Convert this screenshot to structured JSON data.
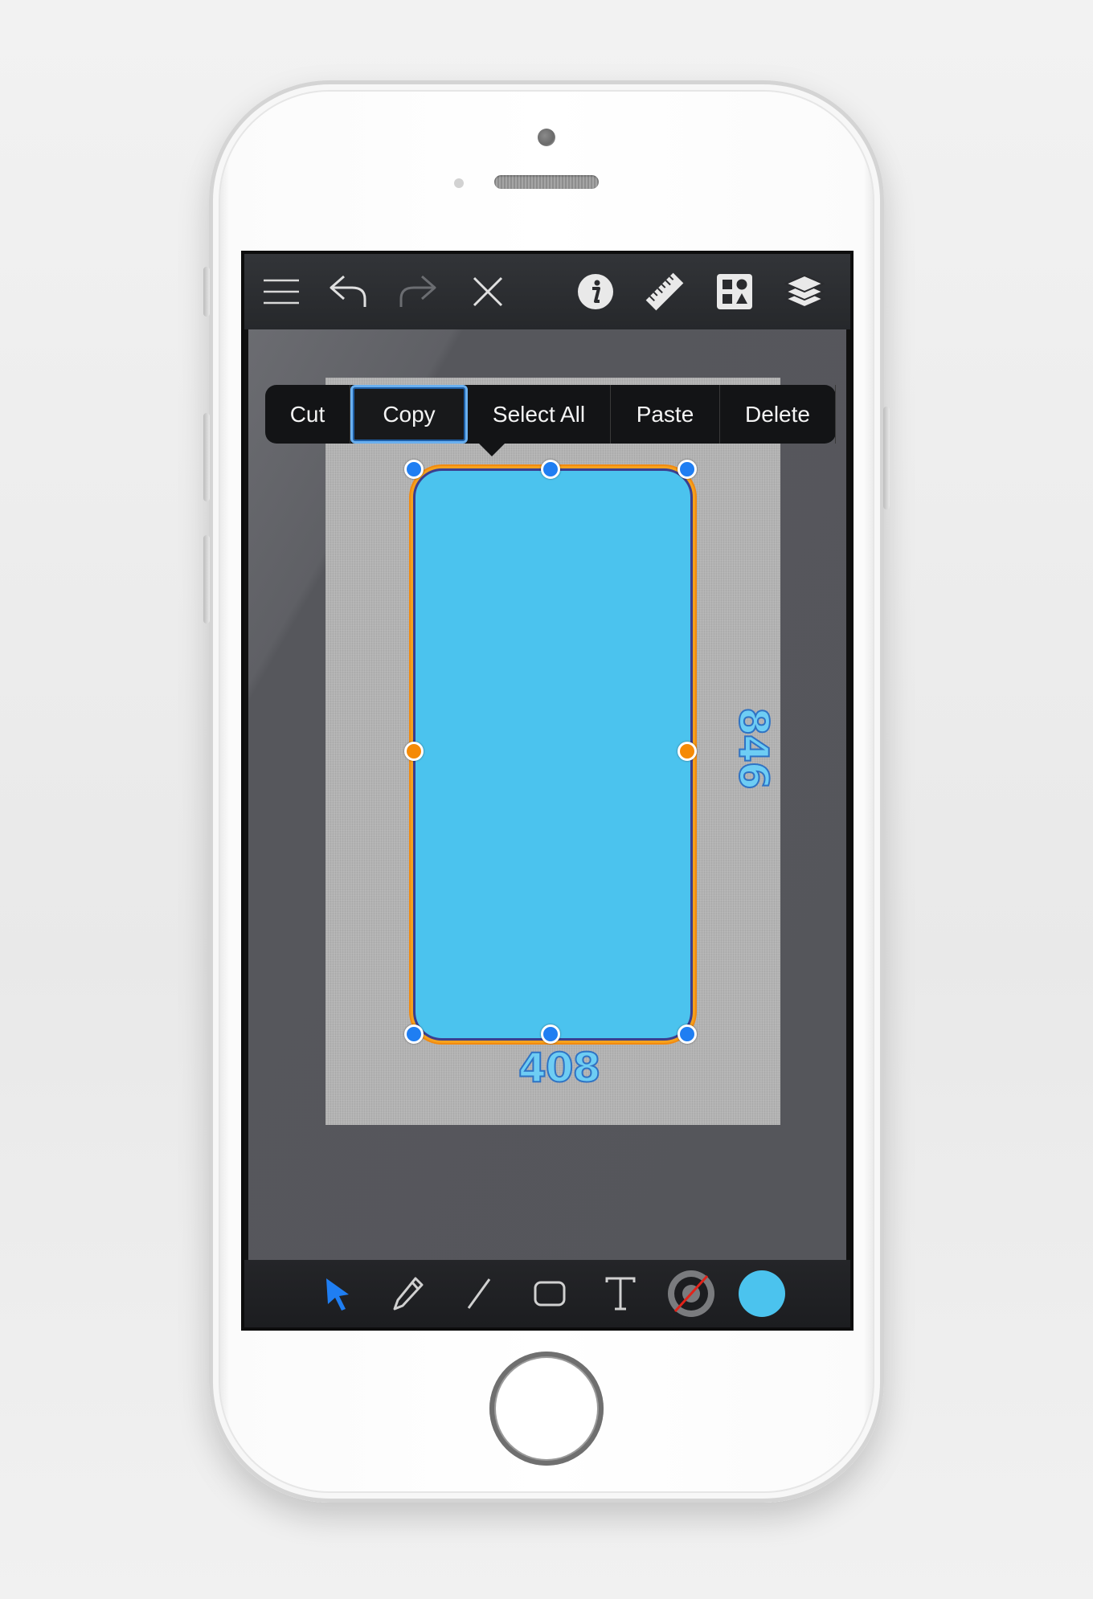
{
  "toolbar": {
    "icons": [
      "menu-icon",
      "undo-icon",
      "redo-icon",
      "close-icon",
      "info-icon",
      "ruler-icon",
      "shapes-library-icon",
      "layers-icon"
    ]
  },
  "context_menu": {
    "items": [
      "Cut",
      "Copy",
      "Select All",
      "Paste",
      "Delete"
    ],
    "selected": "Copy"
  },
  "selection": {
    "width_label": "408",
    "height_label": "846",
    "fill_color": "#4bc3ee",
    "stroke_color": "#3b3f8f",
    "selection_outline_color": "#f5a11d"
  },
  "tools": {
    "items": [
      "select-arrow-icon",
      "pencil-icon",
      "line-icon",
      "rounded-rectangle-icon",
      "text-icon",
      "stroke-color-icon",
      "fill-color-icon"
    ],
    "active": "select-arrow-icon",
    "active_color": "#1f7ef2",
    "fill_swatch": "#4bc3ee"
  }
}
